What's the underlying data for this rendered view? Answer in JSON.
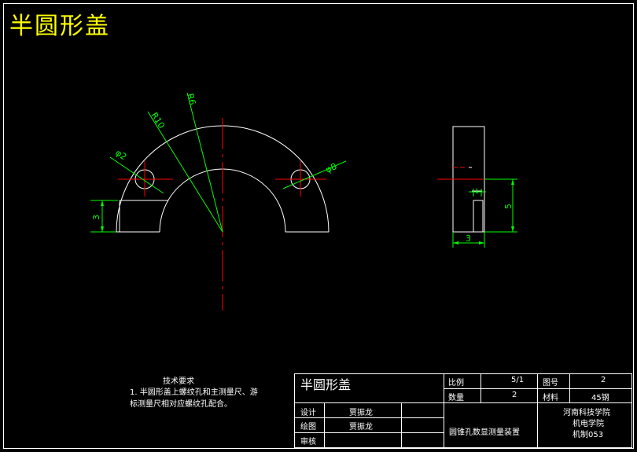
{
  "title": "半圆形盖",
  "colors": {
    "outline": "#ffffff",
    "centerline": "#ff0000",
    "dimension": "#00ff00",
    "title": "#ffff00",
    "background": "#000000"
  },
  "dimensions": {
    "r6": "R6",
    "r10": "R10",
    "phi2": "φ2",
    "phi8": "φ8",
    "h3_left": "3",
    "h5_side": "5",
    "w3_side": "3",
    "small1": "1"
  },
  "notes": {
    "title": "技术要求",
    "line1": "1. 半圆形盖上螺纹孔和主测量尺、游",
    "line2": "标测量尺相对应螺纹孔配合。"
  },
  "title_block": {
    "part_name": "半圆形盖",
    "scale_label": "比例",
    "scale_value": "5/1",
    "drawing_no_label": "图号",
    "drawing_no_value": "2",
    "qty_label": "数量",
    "qty_value": "2",
    "material_label": "材料",
    "material_value": "45钢",
    "design_label": "设计",
    "design_name": "贾振龙",
    "draw_label": "绘图",
    "draw_name": "贾振龙",
    "review_label": "审核",
    "assembly_name": "圆锥孔数显测量装置",
    "school1": "河南科技学院",
    "school2": "机电学院",
    "school3": "机制053"
  }
}
